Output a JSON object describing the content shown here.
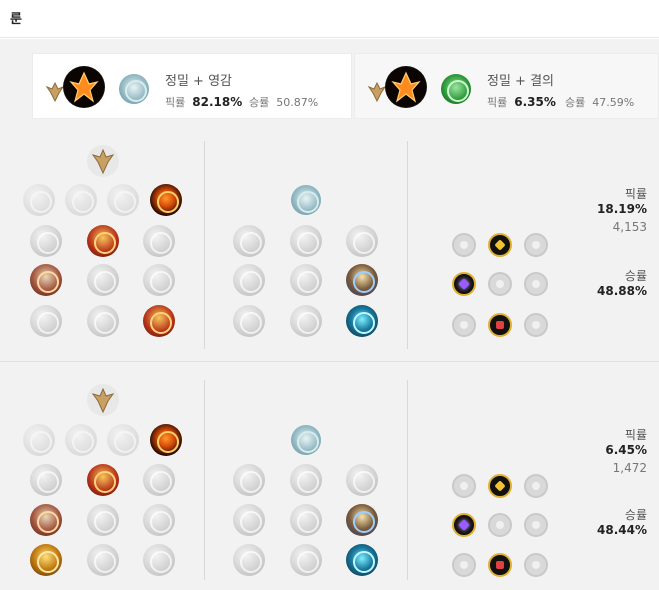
{
  "header": {
    "title": "룬"
  },
  "tabs": [
    {
      "name": "정밀 + 영감",
      "pick_label": "픽률",
      "pick": "82.18%",
      "win_label": "승률",
      "win": "50.87%"
    },
    {
      "name": "정밀 + 결의",
      "pick_label": "픽률",
      "pick": "6.35%",
      "win_label": "승률",
      "win": "47.59%"
    }
  ],
  "builds": [
    {
      "pick_label": "픽률",
      "pick": "18.19%",
      "count": "4,153",
      "win_label": "승률",
      "win": "48.88%"
    },
    {
      "pick_label": "픽률",
      "pick": "6.45%",
      "count": "1,472",
      "win_label": "승률",
      "win": "48.44%"
    }
  ],
  "colors": {
    "accent_gold": "#e0b030",
    "bg": "#f2f2f2"
  }
}
